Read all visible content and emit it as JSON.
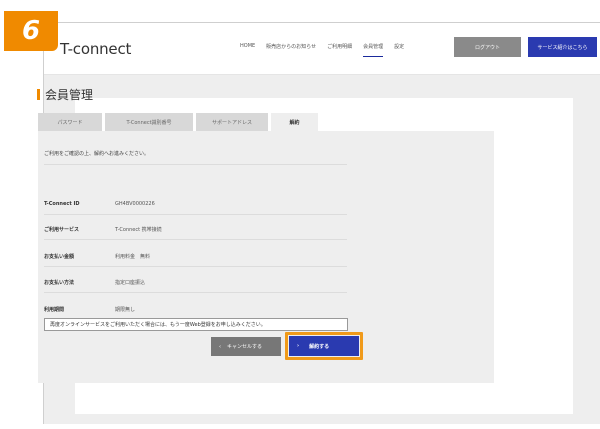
{
  "step": "6",
  "header": {
    "logo": "T-connect",
    "nav": [
      "HOME",
      "販売店からのお知らせ",
      "ご利用明細",
      "会員管理",
      "設定"
    ],
    "active_nav": "会員管理",
    "logout_label": "ログアウト",
    "service_label": "サービス紹介はこちら"
  },
  "page": {
    "title": "会員管理"
  },
  "tabs": [
    {
      "label": "パスワード"
    },
    {
      "label": "T-Connect識別番号"
    },
    {
      "label": "サポートアドレス"
    },
    {
      "label": "解約"
    }
  ],
  "form": {
    "intro": "ご利用をご確認の上、解約へお進みください。",
    "rows": [
      {
        "label": "T-Connect ID",
        "value": "GH4BV0000226"
      },
      {
        "label": "ご利用サービス",
        "value": "T-Connect 携帯接続"
      },
      {
        "label": "お支払い金額",
        "value": "利用料金　無料"
      },
      {
        "label": "お支払い方法",
        "value": "指定口座振込"
      },
      {
        "label": "利用期間",
        "value": "期限無し"
      }
    ],
    "notice": "再度オンラインサービスをご利用いただく場合には、もう一度Web登録をお申し込みください。"
  },
  "buttons": {
    "cancel_label": "キャンセルする",
    "confirm_label": "解約する"
  },
  "colors": {
    "accent": "#f08a00",
    "primary": "#2a3ab0",
    "highlight": "#f09a1a"
  }
}
